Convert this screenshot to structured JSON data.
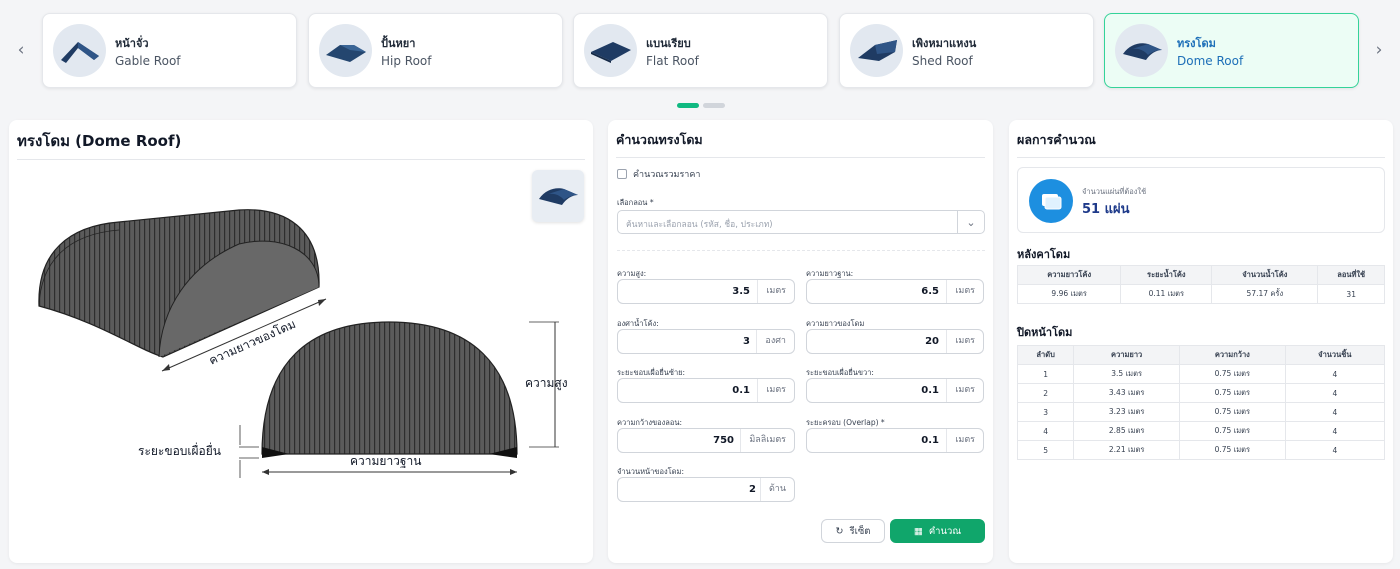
{
  "carousel": {
    "cards": [
      {
        "th": "หน้าจั่ว",
        "en": "Gable Roof",
        "icon": "gable-roof-icon"
      },
      {
        "th": "ปั้นหยา",
        "en": "Hip Roof",
        "icon": "hip-roof-icon"
      },
      {
        "th": "แบนเรียบ",
        "en": "Flat Roof",
        "icon": "flat-roof-icon"
      },
      {
        "th": "เพิงหมาแหงน",
        "en": "Shed Roof",
        "icon": "shed-roof-icon"
      },
      {
        "th": "ทรงโดม",
        "en": "Dome Roof",
        "icon": "dome-roof-icon"
      }
    ],
    "prev_icon": "chevron-left-icon",
    "next_icon": "chevron-right-icon"
  },
  "diagram": {
    "title": "ทรงโดม (Dome Roof)",
    "label_dome_length": "ความยาวของโดม",
    "label_height": "ความสูง",
    "label_base_length": "ความยาวฐาน",
    "label_overhang": "ระยะขอบเผื่อยื่น"
  },
  "calculator": {
    "title": "คำนวณทรงโดม",
    "include_price_label": "คำนวณรวมราคา",
    "sheet_select_label": "เลือกลอน *",
    "sheet_select_placeholder": "ค้นหาและเลือกลอน (รหัส, ชื่อ, ประเภท)",
    "fields": {
      "height": {
        "label": "ความสูง:",
        "value": "3.5",
        "unit": "เมตร"
      },
      "base_length": {
        "label": "ความยาวฐาน:",
        "value": "6.5",
        "unit": "เมตร"
      },
      "bend_angle": {
        "label": "องศาน้ำโค้ง:",
        "value": "3",
        "unit": "องศา"
      },
      "dome_length": {
        "label": "ความยาวของโดม",
        "value": "20",
        "unit": "เมตร"
      },
      "overhang_left": {
        "label": "ระยะขอบเผื่อยื่นซ้าย:",
        "value": "0.1",
        "unit": "เมตร"
      },
      "overhang_right": {
        "label": "ระยะขอบเผื่อยื่นขวา:",
        "value": "0.1",
        "unit": "เมตร"
      },
      "sheet_width": {
        "label": "ความกว้างของลอน:",
        "value": "750",
        "unit": "มิลลิเมตร"
      },
      "overlap": {
        "label": "ระยะครอบ (Overlap) *",
        "value": "0.1",
        "unit": "เมตร"
      },
      "faces": {
        "label": "จำนวนหน้าของโดม:",
        "value": "2",
        "unit": "ด้าน"
      }
    },
    "reset_label": "รีเซ็ต",
    "calculate_label": "คำนวณ"
  },
  "results": {
    "title": "ผลการคำนวณ",
    "summary_label": "จำนวนแผ่นที่ต้องใช้",
    "summary_value": "51 แผ่น",
    "roof_title": "หลังคาโดม",
    "roof_headers": [
      "ความยาวโค้ง",
      "ระยะน้ำโค้ง",
      "จำนวนน้ำโค้ง",
      "ลอนที่ใช้"
    ],
    "roof_row": [
      "9.96 เมตร",
      "0.11 เมตร",
      "57.17 ครั้ง",
      "31"
    ],
    "face_title": "ปิดหน้าโดม",
    "face_headers": [
      "ลำดับ",
      "ความยาว",
      "ความกว้าง",
      "จำนวนชิ้น"
    ],
    "face_rows": [
      [
        "1",
        "3.5 เมตร",
        "0.75 เมตร",
        "4"
      ],
      [
        "2",
        "3.43 เมตร",
        "0.75 เมตร",
        "4"
      ],
      [
        "3",
        "3.23 เมตร",
        "0.75 เมตร",
        "4"
      ],
      [
        "4",
        "2.85 เมตร",
        "0.75 เมตร",
        "4"
      ],
      [
        "5",
        "2.21 เมตร",
        "0.75 เมตร",
        "4"
      ]
    ]
  }
}
